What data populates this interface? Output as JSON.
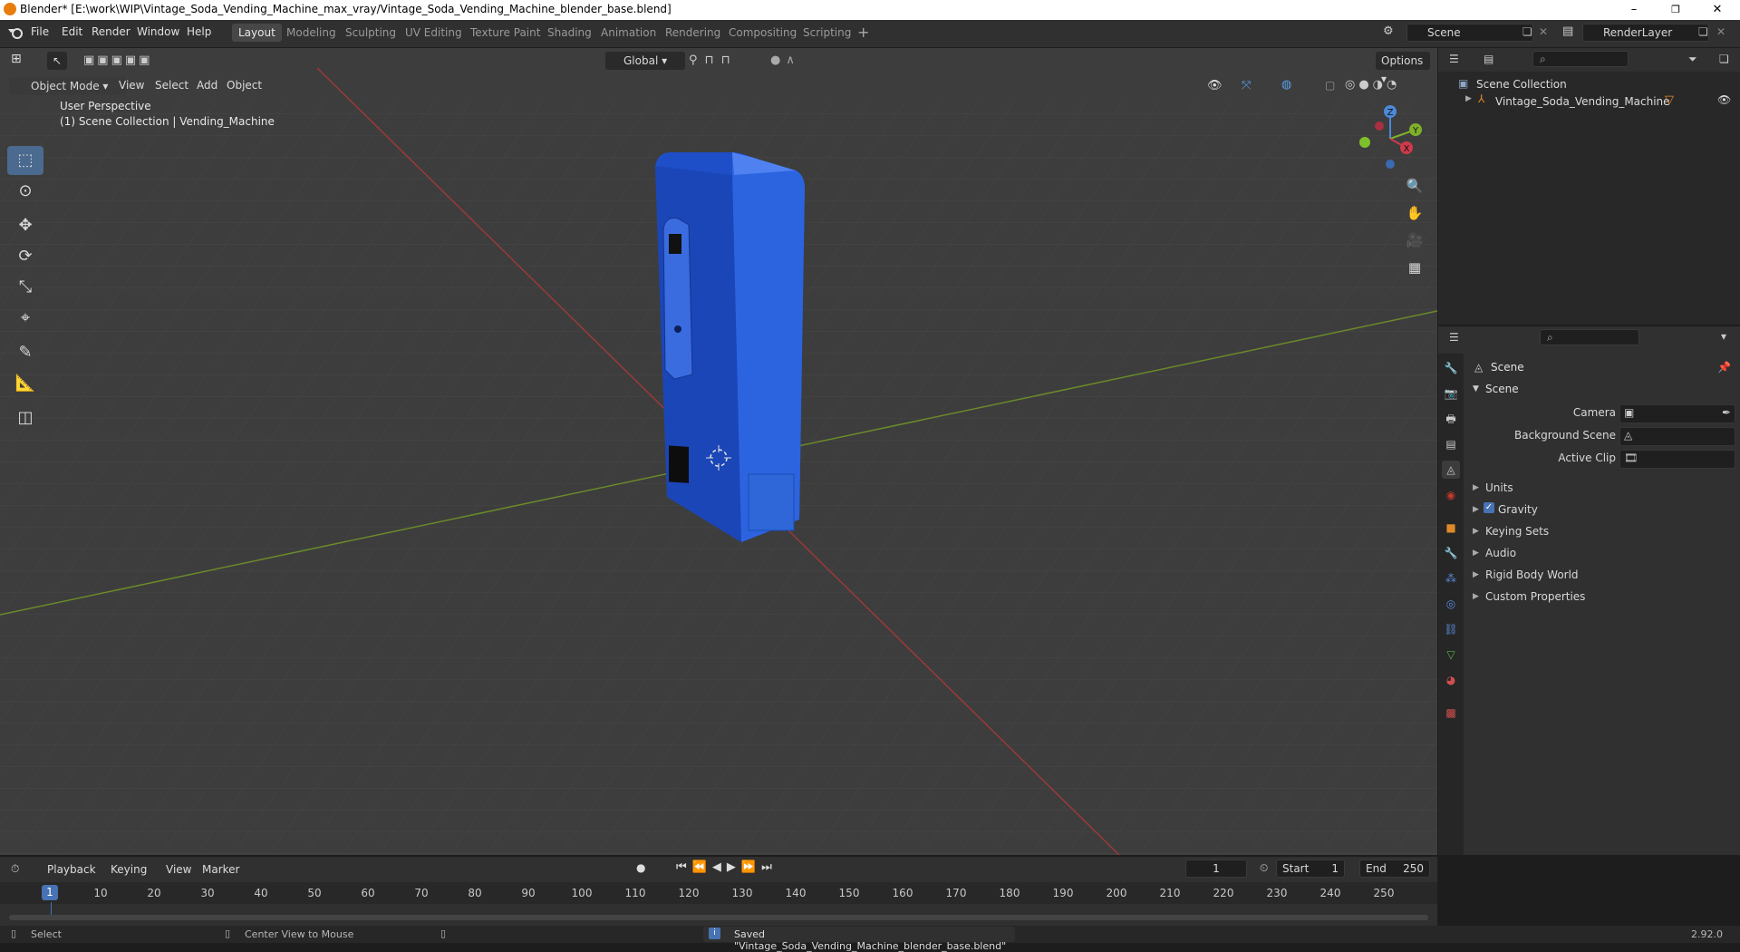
{
  "window": {
    "title": "Blender* [E:\\work\\WIP\\Vintage_Soda_Vending_Machine_max_vray/Vintage_Soda_Vending_Machine_blender_base.blend]",
    "min_glyph": "–",
    "max_glyph": "❐",
    "close_glyph": "✕"
  },
  "menus": [
    "File",
    "Edit",
    "Render",
    "Window",
    "Help"
  ],
  "workspaces": [
    "Layout",
    "Modeling",
    "Sculpting",
    "UV Editing",
    "Texture Paint",
    "Shading",
    "Animation",
    "Rendering",
    "Compositing",
    "Scripting"
  ],
  "active_workspace": "Layout",
  "scene_name": "Scene",
  "render_layer": "RenderLayer",
  "viewport": {
    "mode": "Object Mode",
    "menu": [
      "View",
      "Select",
      "Add",
      "Object"
    ],
    "orientation": "Global",
    "options": "Options",
    "perspective": "User Perspective",
    "collection_info": "(1) Scene Collection | Vending_Machine",
    "gizmo": {
      "x": "X",
      "y": "Y",
      "z": "Z"
    }
  },
  "outliner": {
    "root": "Scene Collection",
    "items": [
      "Vintage_Soda_Vending_Machine"
    ]
  },
  "properties": {
    "context": "Scene",
    "panel": "Scene",
    "fields": [
      {
        "label": "Camera"
      },
      {
        "label": "Background Scene"
      },
      {
        "label": "Active Clip"
      }
    ],
    "sections": [
      "Units",
      "Gravity",
      "Keying Sets",
      "Audio",
      "Rigid Body World",
      "Custom Properties"
    ],
    "gravity_checked": true
  },
  "timeline": {
    "menu": [
      "Playback",
      "Keying",
      "View",
      "Marker"
    ],
    "current_frame": "1",
    "start_label": "Start",
    "start": "1",
    "end_label": "End",
    "end": "250",
    "ticks": [
      "10",
      "20",
      "30",
      "40",
      "50",
      "60",
      "70",
      "80",
      "90",
      "100",
      "110",
      "120",
      "130",
      "140",
      "150",
      "160",
      "170",
      "180",
      "190",
      "200",
      "210",
      "220",
      "230",
      "240",
      "250"
    ],
    "frame_marker": "1"
  },
  "status": {
    "select": "Select",
    "center": "Center View to Mouse",
    "saved": "Saved \"Vintage_Soda_Vending_Machine_blender_base.blend\"",
    "version": "2.92.0"
  }
}
